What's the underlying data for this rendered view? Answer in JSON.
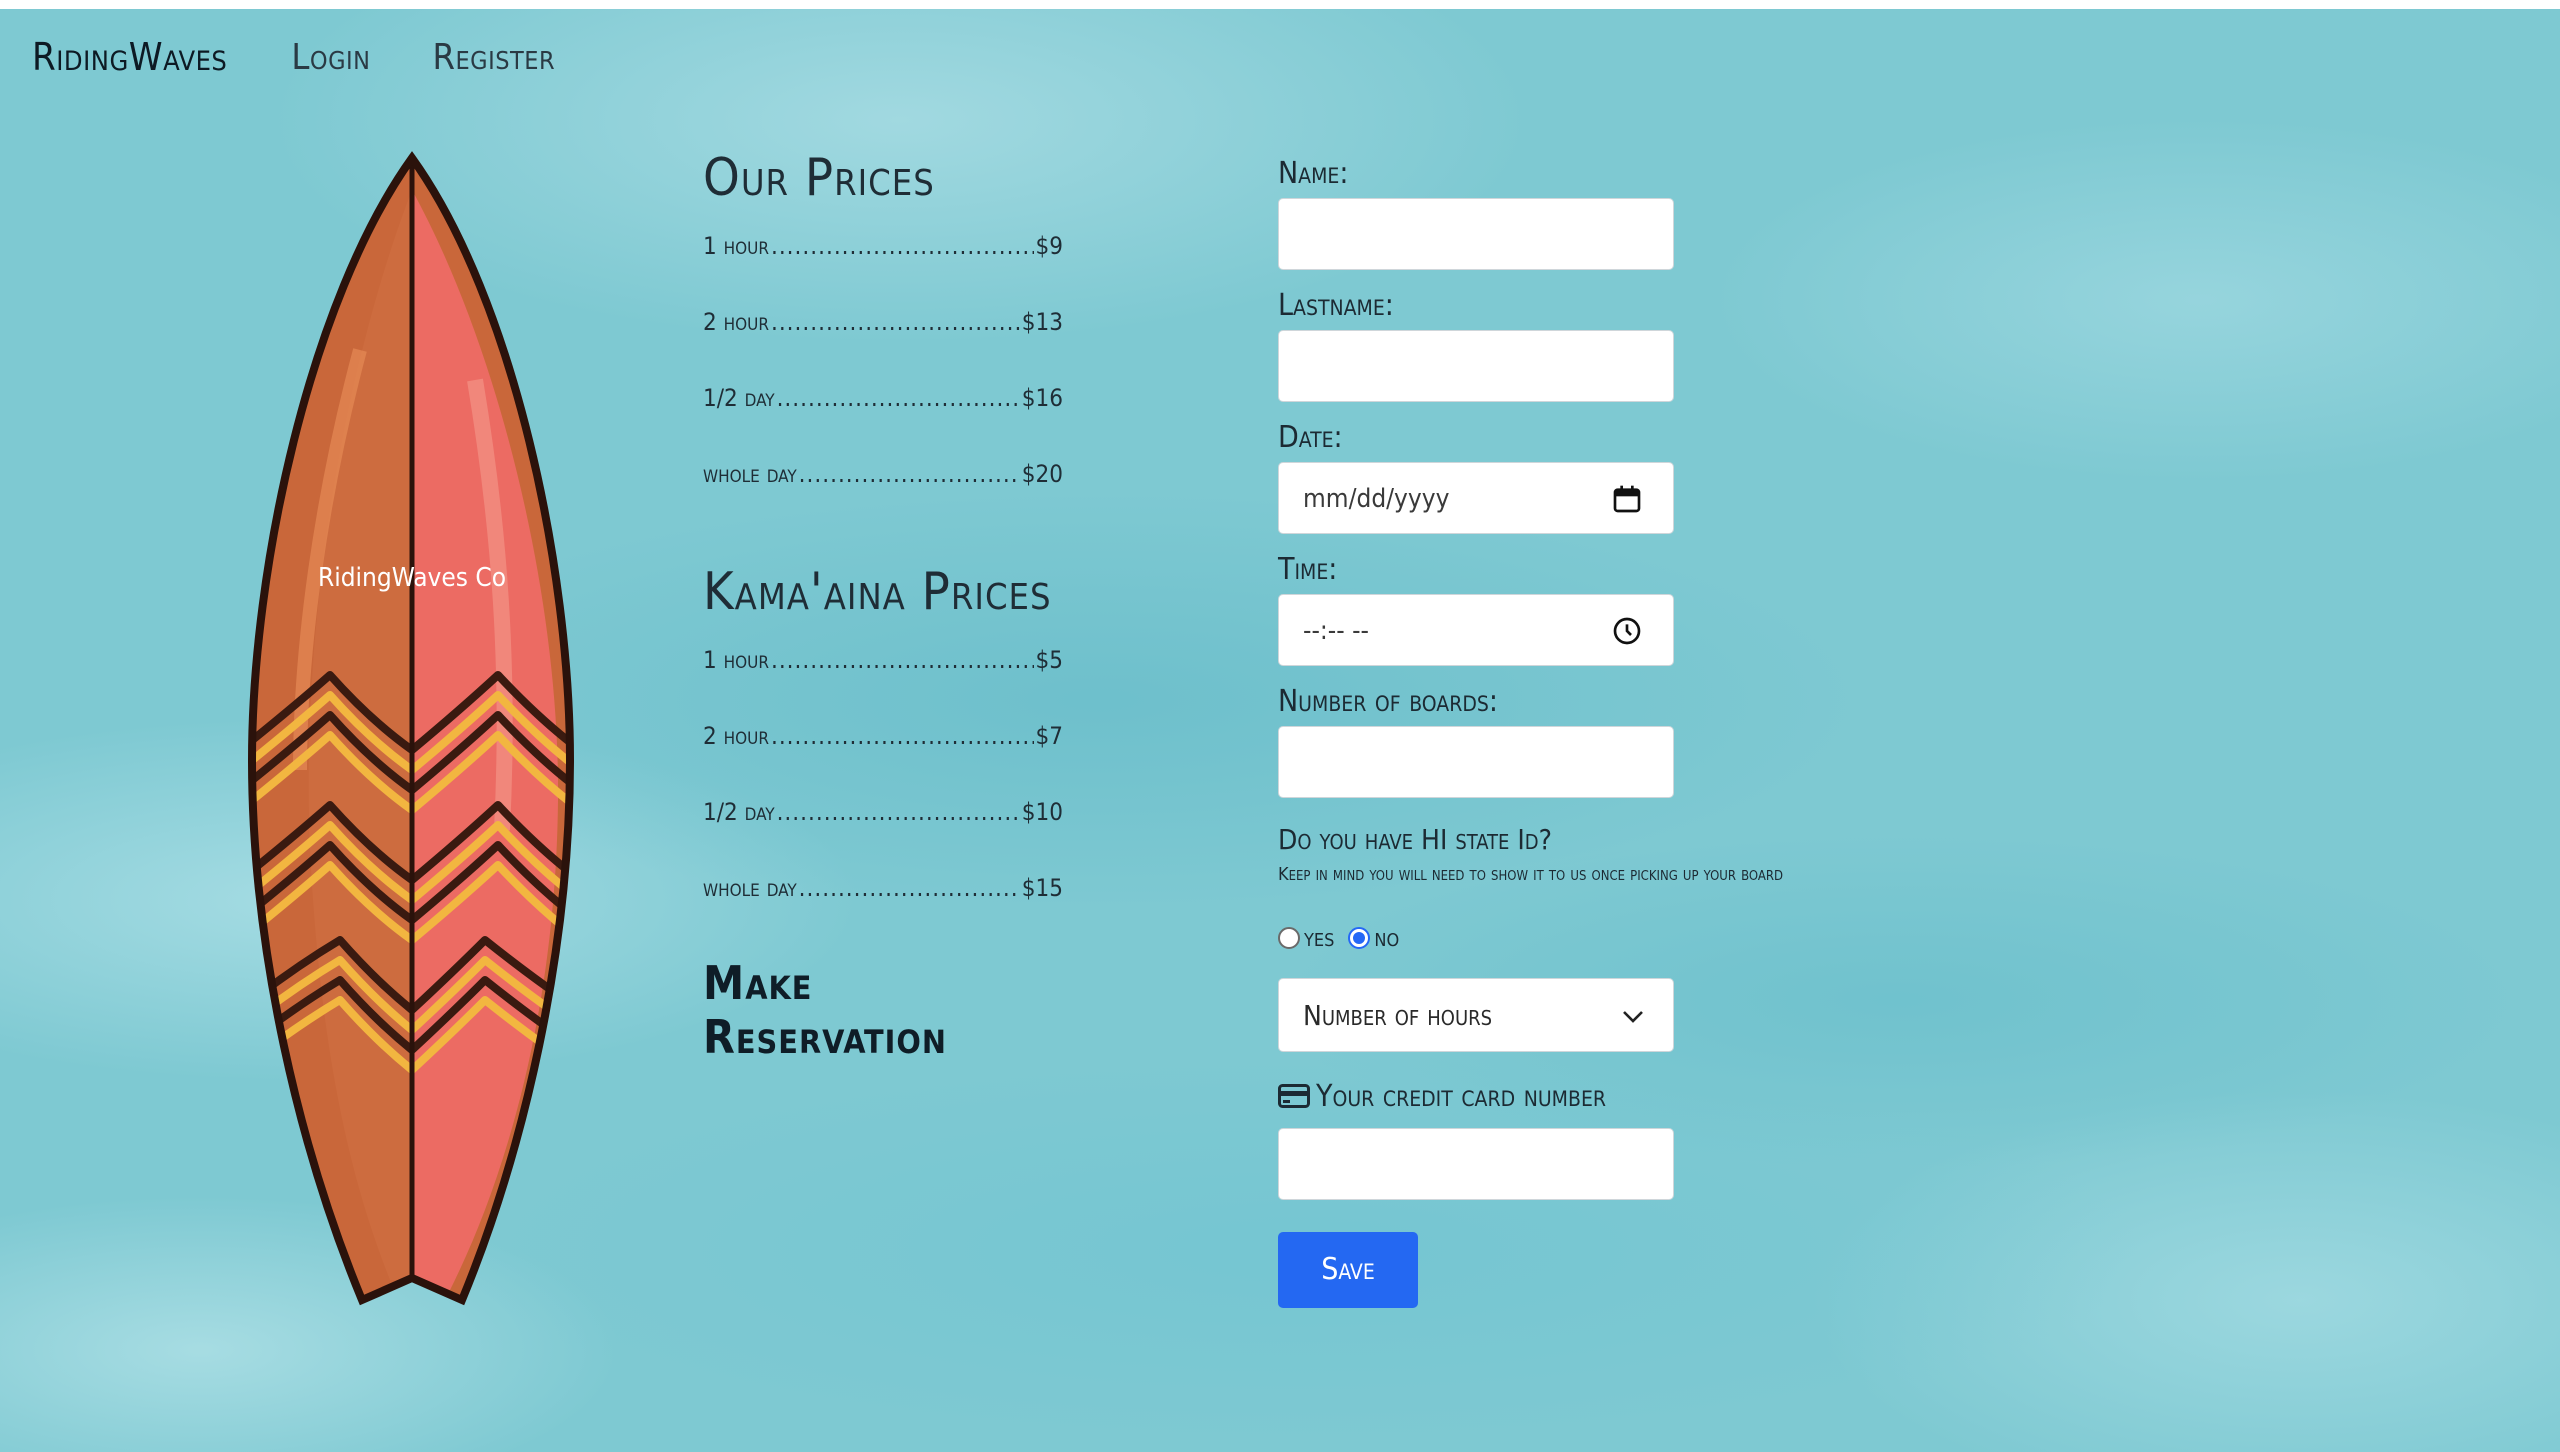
{
  "nav": {
    "brand": "RidingWaves",
    "login": "Login",
    "register": "Register"
  },
  "board": {
    "text": "RidingWaves Co"
  },
  "prices": {
    "title": "Our Prices",
    "items": [
      {
        "label": "1 hour",
        "price": "$9"
      },
      {
        "label": "2 hour",
        "price": "$13"
      },
      {
        "label": "1/2 day",
        "price": "$16"
      },
      {
        "label": "whole day",
        "price": "$20"
      }
    ],
    "kamaaina_title": "Kama'aina Prices",
    "kamaaina_items": [
      {
        "label": "1 hour",
        "price": "$5"
      },
      {
        "label": "2 hour",
        "price": "$7"
      },
      {
        "label": "1/2 day",
        "price": "$10"
      },
      {
        "label": "whole day",
        "price": "$15"
      }
    ],
    "make_reservation": "Make Reservation"
  },
  "form": {
    "name_label": "Name:",
    "lastname_label": "Lastname:",
    "date_label": "Date:",
    "date_placeholder": "mm/dd/yyyy",
    "time_label": "Time:",
    "time_placeholder": "--:-- --",
    "boards_label": "Number of boards:",
    "state_id_question": "Do you have HI state Id?",
    "state_id_note": "Keep in mind you will need to show it to us once picking up your board",
    "yes_label": "yes",
    "no_label": "no",
    "selected_radio": "no",
    "hours_select": "Number of hours",
    "cc_label": "Your credit card number",
    "save_label": "Save"
  },
  "colors": {
    "accent": "#2468f2",
    "background": "#7ec9d2"
  },
  "icons": {
    "date": "calendar-icon",
    "time": "clock-icon",
    "select": "chevron-down-icon",
    "cc": "credit-card-icon"
  }
}
